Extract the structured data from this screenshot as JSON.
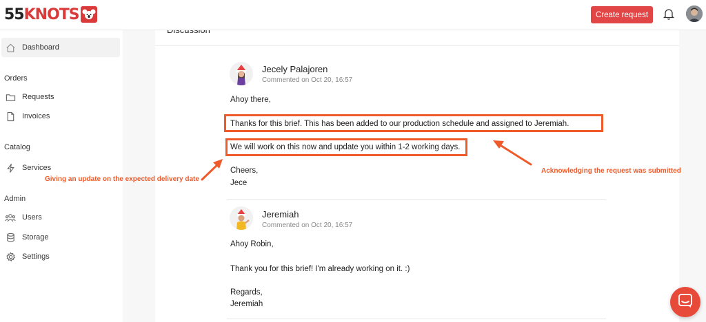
{
  "brand": {
    "logo_dark": "55",
    "logo_red": "KNOTS",
    "color": "#d93a3a"
  },
  "header": {
    "create_button": "Create request",
    "accent": "#e14545",
    "icons": [
      "bell-icon",
      "user-avatar"
    ]
  },
  "sidebar": {
    "dashboard": "Dashboard",
    "orders_label": "Orders",
    "requests": "Requests",
    "invoices": "Invoices",
    "catalog_label": "Catalog",
    "services": "Services",
    "admin_label": "Admin",
    "users": "Users",
    "storage": "Storage",
    "settings": "Settings"
  },
  "main": {
    "section_title": "Discussion",
    "comments": [
      {
        "author": "Jecely Palajoren",
        "time": "Commented on Oct 20, 16:57",
        "lines": [
          "Ahoy there,",
          "Thanks for this brief. This has been added to our production schedule and assigned to Jeremiah.",
          "We will work on this now and update you within 1-2 working days.",
          "Cheers,",
          "Jece"
        ]
      },
      {
        "author": "Jeremiah",
        "time": "Commented on Oct 20, 16:57",
        "lines": [
          "Ahoy Robin,",
          "Thank you for this brief! I'm already working on it. :)",
          "Regards,",
          "Jeremiah"
        ]
      }
    ]
  },
  "annotations": {
    "left": "Giving an update on the expected delivery date",
    "right": "Acknowledging the request was submitted",
    "color": "#ef5a2a"
  }
}
